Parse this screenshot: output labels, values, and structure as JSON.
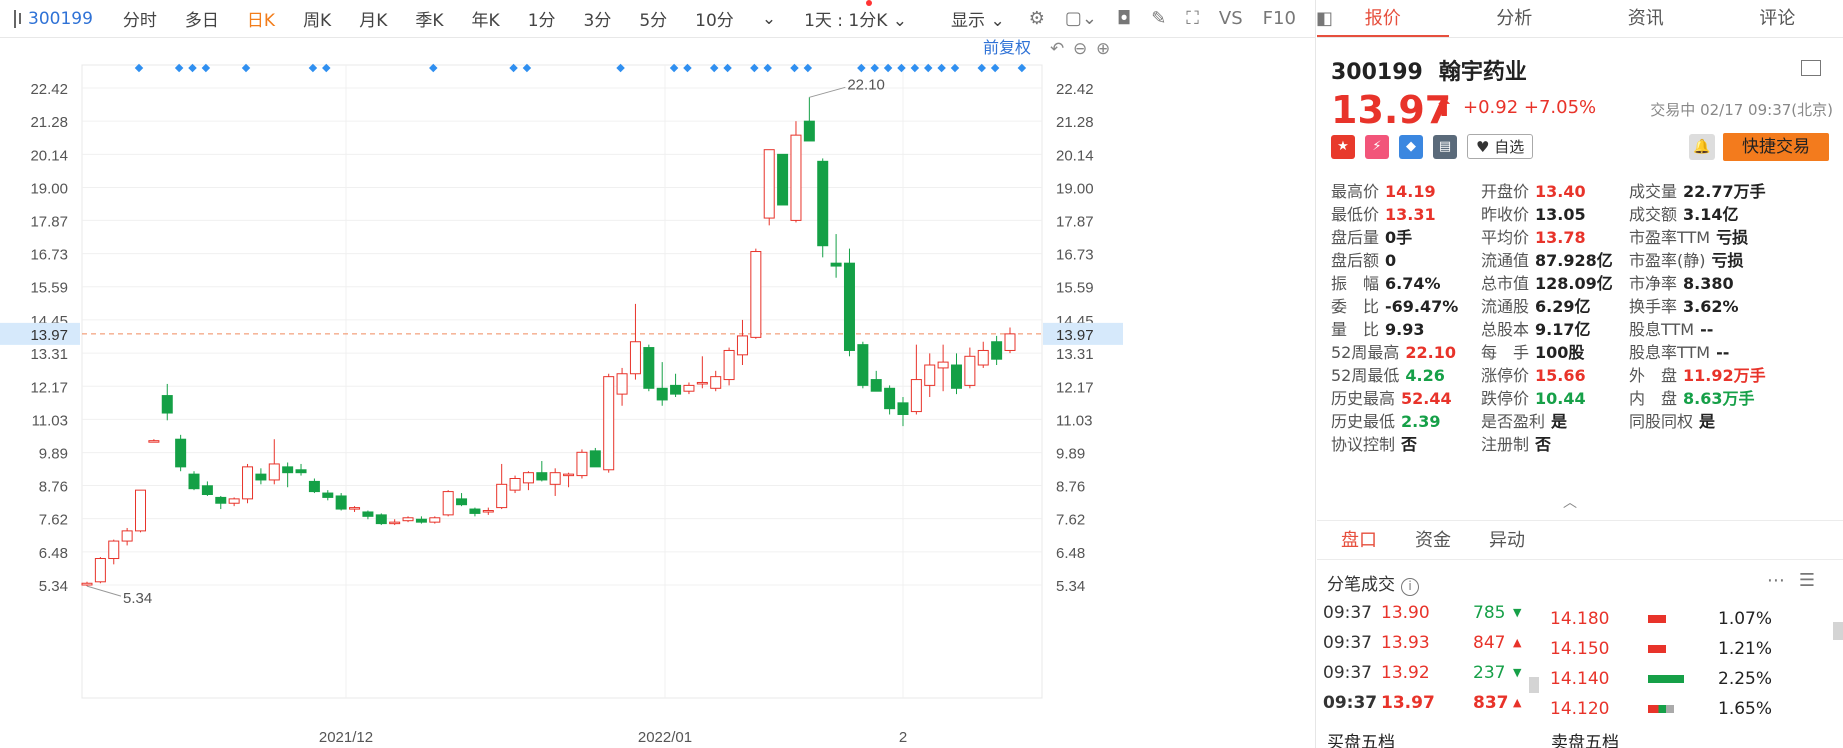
{
  "toolbar": {
    "code": "300199",
    "periods": [
      "分时",
      "多日",
      "日K",
      "周K",
      "月K",
      "季K",
      "年K",
      "1分",
      "3分",
      "5分",
      "10分"
    ],
    "active_period": "日K",
    "k_setting": "1天 : 1分K",
    "display_label": "显示",
    "vs_label": "VS",
    "f10_label": "F10"
  },
  "chart_top": {
    "adjust_label": "前复权"
  },
  "chart_data": {
    "type": "candlestick",
    "y_ticks": [
      "22.42",
      "21.28",
      "20.14",
      "19.00",
      "17.87",
      "16.73",
      "15.59",
      "14.45",
      "13.31",
      "12.17",
      "11.03",
      "9.89",
      "8.76",
      "7.62",
      "6.48",
      "5.34"
    ],
    "x_ticks": [
      "2021/12",
      "2022/01",
      "2"
    ],
    "current_price_label": "13.97",
    "high_annotation": "22.10",
    "low_annotation": "5.34",
    "candles": [
      [
        5.34,
        5.45,
        5.3,
        5.4
      ],
      [
        5.45,
        6.3,
        5.4,
        6.25
      ],
      [
        6.25,
        6.9,
        6.05,
        6.85
      ],
      [
        6.85,
        7.3,
        6.7,
        7.2
      ],
      [
        7.2,
        8.6,
        7.15,
        8.6
      ],
      [
        10.3,
        10.35,
        10.25,
        10.3
      ],
      [
        11.85,
        12.25,
        11.0,
        11.25
      ],
      [
        10.35,
        10.5,
        9.25,
        9.4
      ],
      [
        9.15,
        9.25,
        8.6,
        8.65
      ],
      [
        8.75,
        8.9,
        8.4,
        8.45
      ],
      [
        8.35,
        8.4,
        7.95,
        8.15
      ],
      [
        8.15,
        8.35,
        8.05,
        8.3
      ],
      [
        8.3,
        9.5,
        8.15,
        9.4
      ],
      [
        9.15,
        9.35,
        8.8,
        8.95
      ],
      [
        8.95,
        10.35,
        8.8,
        9.5
      ],
      [
        9.4,
        9.55,
        8.7,
        9.2
      ],
      [
        9.3,
        9.5,
        9.1,
        9.2
      ],
      [
        8.9,
        9.0,
        8.5,
        8.55
      ],
      [
        8.5,
        8.6,
        8.25,
        8.35
      ],
      [
        8.4,
        8.5,
        7.9,
        7.95
      ],
      [
        7.95,
        8.05,
        7.85,
        8.0
      ],
      [
        7.85,
        7.9,
        7.6,
        7.7
      ],
      [
        7.75,
        7.8,
        7.4,
        7.45
      ],
      [
        7.5,
        7.6,
        7.4,
        7.5
      ],
      [
        7.55,
        7.7,
        7.5,
        7.65
      ],
      [
        7.6,
        7.7,
        7.45,
        7.5
      ],
      [
        7.5,
        7.7,
        7.45,
        7.65
      ],
      [
        7.75,
        8.6,
        7.7,
        8.55
      ],
      [
        8.3,
        8.5,
        8.05,
        8.1
      ],
      [
        7.95,
        8.0,
        7.7,
        7.8
      ],
      [
        7.85,
        8.0,
        7.75,
        7.9
      ],
      [
        8.0,
        9.5,
        7.95,
        8.8
      ],
      [
        8.6,
        9.1,
        8.5,
        9.0
      ],
      [
        8.85,
        9.25,
        8.6,
        9.2
      ],
      [
        9.2,
        9.6,
        8.9,
        8.95
      ],
      [
        8.8,
        9.35,
        8.4,
        9.2
      ],
      [
        9.1,
        9.2,
        8.7,
        9.15
      ],
      [
        9.1,
        10.0,
        9.0,
        9.9
      ],
      [
        9.95,
        10.05,
        9.4,
        9.4
      ],
      [
        9.3,
        12.6,
        9.2,
        12.5
      ],
      [
        11.9,
        12.8,
        11.5,
        12.6
      ],
      [
        12.6,
        15.0,
        12.4,
        13.7
      ],
      [
        13.5,
        13.6,
        12.0,
        12.1
      ],
      [
        12.1,
        13.0,
        11.5,
        11.7
      ],
      [
        12.2,
        12.6,
        11.8,
        11.9
      ],
      [
        12.0,
        12.3,
        11.9,
        12.2
      ],
      [
        12.25,
        13.2,
        12.1,
        12.3
      ],
      [
        12.1,
        12.7,
        12.0,
        12.5
      ],
      [
        12.4,
        13.5,
        12.2,
        13.4
      ],
      [
        13.25,
        14.45,
        12.9,
        13.9
      ],
      [
        13.85,
        16.9,
        13.8,
        16.8
      ],
      [
        17.95,
        20.3,
        17.7,
        20.3
      ],
      [
        20.14,
        20.14,
        18.4,
        18.4
      ],
      [
        17.87,
        21.28,
        17.8,
        20.8
      ],
      [
        21.28,
        22.1,
        20.6,
        20.6
      ],
      [
        19.9,
        20.0,
        16.6,
        17.0
      ],
      [
        16.4,
        17.4,
        15.9,
        16.3
      ],
      [
        16.4,
        16.9,
        13.2,
        13.4
      ],
      [
        13.6,
        13.7,
        12.1,
        12.2
      ],
      [
        12.4,
        12.7,
        12.0,
        12.0
      ],
      [
        12.1,
        12.2,
        11.2,
        11.4
      ],
      [
        11.6,
        11.8,
        10.8,
        11.2
      ],
      [
        11.3,
        13.6,
        11.2,
        12.4
      ],
      [
        12.2,
        13.3,
        11.8,
        12.9
      ],
      [
        12.8,
        13.6,
        12.0,
        13.0
      ],
      [
        12.9,
        13.3,
        11.9,
        12.1
      ],
      [
        12.2,
        13.5,
        12.1,
        13.2
      ],
      [
        12.9,
        13.7,
        12.8,
        13.4
      ],
      [
        13.7,
        13.9,
        12.9,
        13.1
      ],
      [
        13.4,
        14.19,
        13.31,
        13.97
      ]
    ],
    "markers": [
      0,
      3,
      4,
      5,
      8,
      13,
      14,
      22,
      28,
      29,
      36,
      40,
      41,
      43,
      44,
      46,
      47,
      49,
      50,
      54,
      55,
      56,
      57,
      58,
      59,
      60,
      61,
      63,
      64,
      66,
      67,
      68,
      69,
      71,
      72
    ]
  },
  "quote_tabs": [
    "报价",
    "分析",
    "资讯",
    "评论"
  ],
  "stock": {
    "code": "300199",
    "name": "翰宇药业",
    "price": "13.97",
    "change": "+0.92 +7.05%",
    "trade_time": "交易中 02/17 09:37(北京)",
    "watch_label": "自选",
    "quick_trade_label": "快捷交易"
  },
  "stats": [
    [
      {
        "l": "最高价",
        "v": "14.19",
        "c": "red"
      },
      {
        "l": "开盘价",
        "v": "13.40",
        "c": "red"
      },
      {
        "l": "成交量",
        "v": "22.77万手",
        "c": ""
      }
    ],
    [
      {
        "l": "最低价",
        "v": "13.31",
        "c": "red"
      },
      {
        "l": "昨收价",
        "v": "13.05",
        "c": ""
      },
      {
        "l": "成交额",
        "v": "3.14亿",
        "c": ""
      }
    ],
    [
      {
        "l": "盘后量",
        "v": "0手",
        "c": ""
      },
      {
        "l": "平均价",
        "v": "13.78",
        "c": "red"
      },
      {
        "l": "市盈率TTM",
        "v": "亏损",
        "c": ""
      }
    ],
    [
      {
        "l": "盘后额",
        "v": "0",
        "c": ""
      },
      {
        "l": "流通值",
        "v": "87.928亿",
        "c": ""
      },
      {
        "l": "市盈率(静)",
        "v": "亏损",
        "c": ""
      }
    ],
    [
      {
        "l": "振　幅",
        "v": "6.74%",
        "c": ""
      },
      {
        "l": "总市值",
        "v": "128.09亿",
        "c": ""
      },
      {
        "l": "市净率",
        "v": "8.380",
        "c": ""
      }
    ],
    [
      {
        "l": "委　比",
        "v": "-69.47%",
        "c": ""
      },
      {
        "l": "流通股",
        "v": "6.29亿",
        "c": ""
      },
      {
        "l": "换手率",
        "v": "3.62%",
        "c": ""
      }
    ],
    [
      {
        "l": "量　比",
        "v": "9.93",
        "c": ""
      },
      {
        "l": "总股本",
        "v": "9.17亿",
        "c": ""
      },
      {
        "l": "股息TTM",
        "v": "--",
        "c": ""
      }
    ],
    [
      {
        "l": "52周最高",
        "v": "22.10",
        "c": "red"
      },
      {
        "l": "每　手",
        "v": "100股",
        "c": ""
      },
      {
        "l": "股息率TTM",
        "v": "--",
        "c": ""
      }
    ],
    [
      {
        "l": "52周最低",
        "v": "4.26",
        "c": "green"
      },
      {
        "l": "涨停价",
        "v": "15.66",
        "c": "red"
      },
      {
        "l": "外　盘",
        "v": "11.92万手",
        "c": "red"
      }
    ],
    [
      {
        "l": "历史最高",
        "v": "52.44",
        "c": "red"
      },
      {
        "l": "跌停价",
        "v": "10.44",
        "c": "green"
      },
      {
        "l": "内　盘",
        "v": "8.63万手",
        "c": "green"
      }
    ],
    [
      {
        "l": "历史最低",
        "v": "2.39",
        "c": "green"
      },
      {
        "l": "是否盈利",
        "v": "是",
        "c": ""
      },
      {
        "l": "同股同权",
        "v": "是",
        "c": ""
      }
    ],
    [
      {
        "l": "协议控制",
        "v": "否",
        "c": ""
      },
      {
        "l": "注册制",
        "v": "否",
        "c": ""
      },
      {
        "l": "",
        "v": "",
        "c": ""
      }
    ]
  ],
  "sub_tabs": [
    "盘口",
    "资金",
    "异动"
  ],
  "trades_title": "分笔成交",
  "trades": [
    {
      "t": "09:37",
      "p": "13.90",
      "v": "785",
      "d": "down"
    },
    {
      "t": "09:37",
      "p": "13.93",
      "v": "847",
      "d": "up"
    },
    {
      "t": "09:37",
      "p": "13.92",
      "v": "237",
      "d": "down"
    },
    {
      "t": "09:37",
      "p": "13.97",
      "v": "837",
      "d": "up"
    }
  ],
  "book": [
    {
      "p": "14.180",
      "pct": "1.07%",
      "w": 18
    },
    {
      "p": "14.150",
      "pct": "1.21%",
      "w": 18
    },
    {
      "p": "14.140",
      "pct": "2.25%",
      "w": 36
    },
    {
      "p": "14.120",
      "pct": "1.65%",
      "w": 26
    }
  ],
  "bottom_labels": {
    "buy": "买盘五档",
    "sell": "卖盘五档"
  }
}
